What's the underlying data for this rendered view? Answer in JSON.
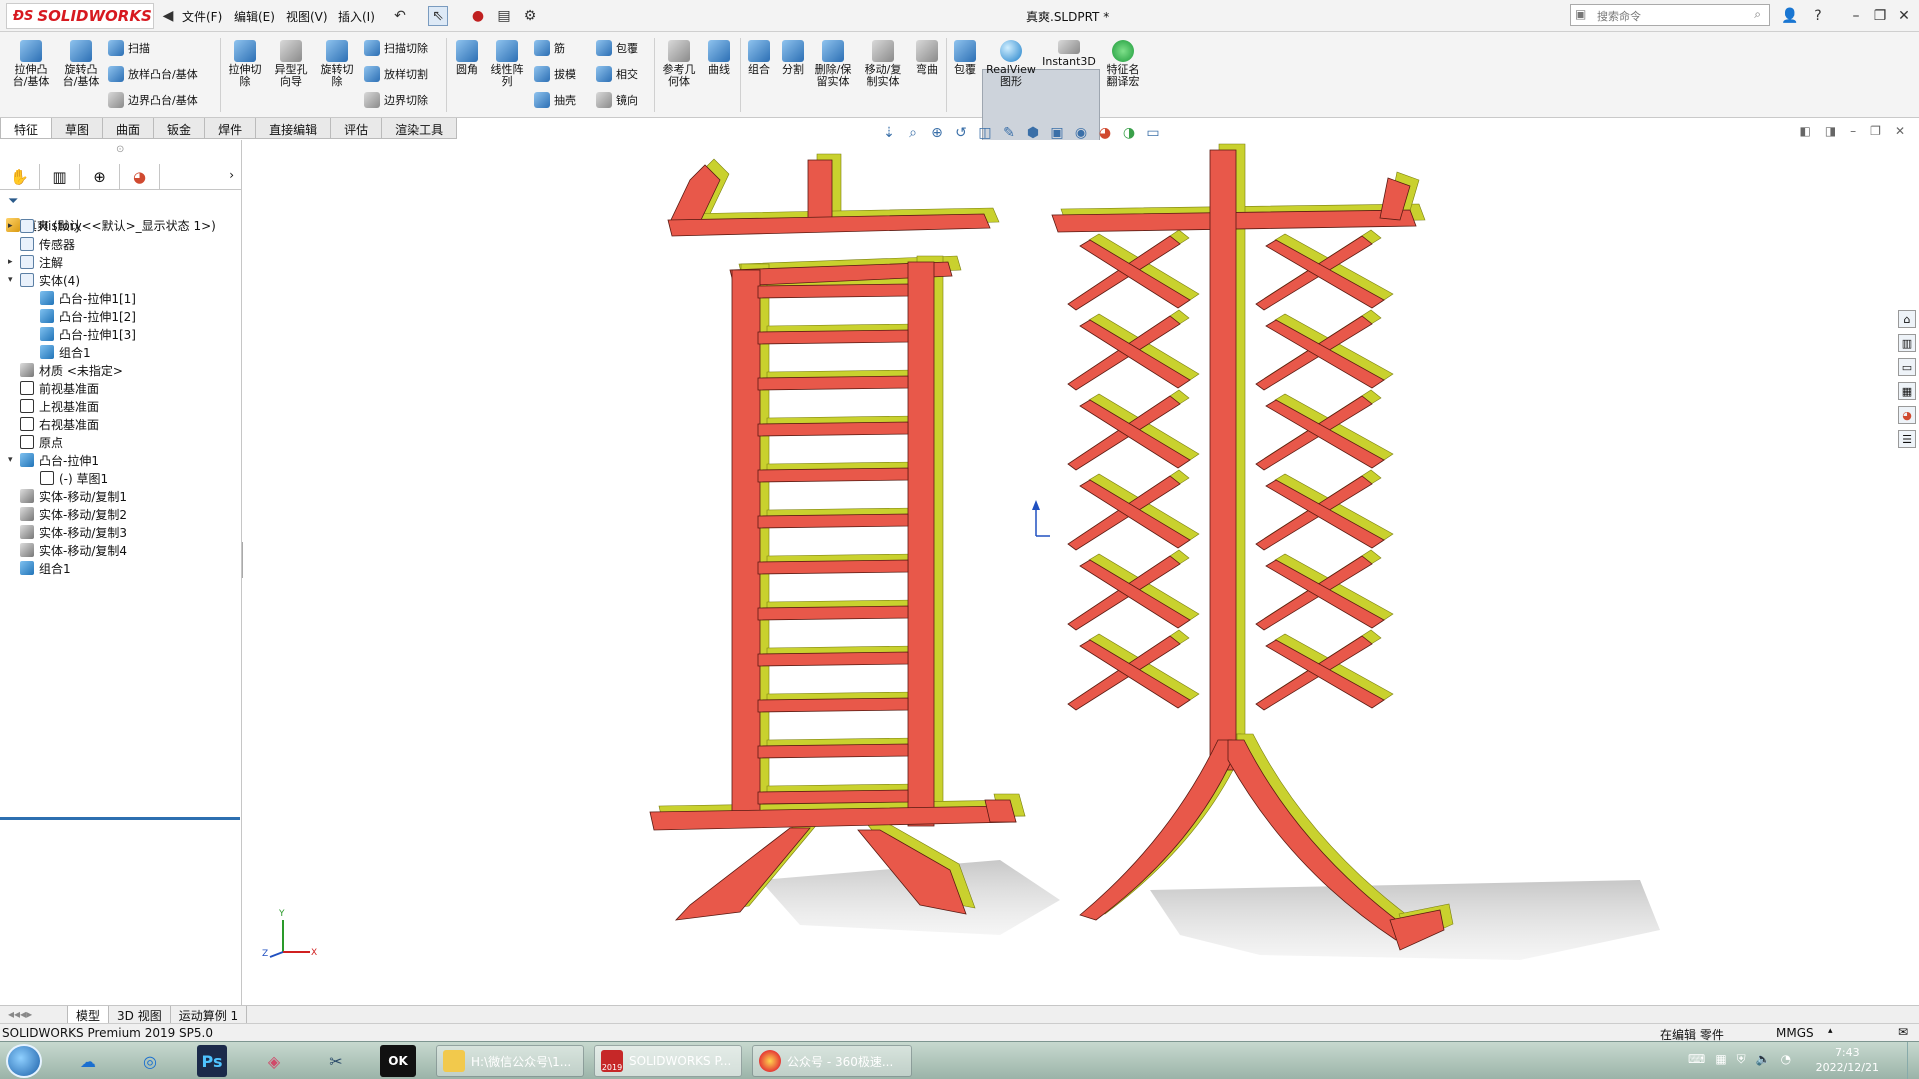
{
  "titlebar": {
    "app_brand": "SOLIDWORKS",
    "menus": [
      "文件(F)",
      "编辑(E)",
      "视图(V)",
      "插入(I)"
    ],
    "document_title": "真爽.SLDPRT *",
    "search_placeholder": "搜索命令",
    "help_symbol": "?"
  },
  "ribbon": {
    "large_buttons": [
      {
        "id": "extrude-boss",
        "label_lines": [
          "拉伸凸",
          "台/基体"
        ],
        "icon": "extrude-boss-icon"
      },
      {
        "id": "revolve-boss",
        "label_lines": [
          "旋转凸",
          "台/基体"
        ],
        "icon": "revolve-boss-icon"
      },
      {
        "id": "extrude-cut",
        "label_lines": [
          "拉伸切",
          "除"
        ],
        "icon": "extrude-cut-icon"
      },
      {
        "id": "hole-wizard",
        "label_lines": [
          "异型孔",
          "向导"
        ],
        "icon": "hole-wizard-icon"
      },
      {
        "id": "revolve-cut",
        "label_lines": [
          "旋转切",
          "除"
        ],
        "icon": "revolve-cut-icon"
      },
      {
        "id": "fillet",
        "label_lines": [
          "圆角"
        ],
        "icon": "fillet-icon"
      },
      {
        "id": "linear-pattern",
        "label_lines": [
          "线性阵",
          "列"
        ],
        "icon": "linear-pattern-icon"
      },
      {
        "id": "ref-geometry",
        "label_lines": [
          "参考几",
          "何体"
        ],
        "icon": "ref-geometry-icon"
      },
      {
        "id": "curves",
        "label_lines": [
          "曲线"
        ],
        "icon": "curves-icon"
      },
      {
        "id": "combine",
        "label_lines": [
          "组合"
        ],
        "icon": "combine-icon"
      },
      {
        "id": "split",
        "label_lines": [
          "分割"
        ],
        "icon": "split-icon"
      },
      {
        "id": "delete-keep-body",
        "label_lines": [
          "删除/保",
          "留实体"
        ],
        "icon": "delete-body-icon"
      },
      {
        "id": "move-copy-body",
        "label_lines": [
          "移动/复",
          "制实体"
        ],
        "icon": "move-copy-icon"
      },
      {
        "id": "flex",
        "label_lines": [
          "弯曲"
        ],
        "icon": "flex-icon"
      },
      {
        "id": "wrap",
        "label_lines": [
          "包覆"
        ],
        "icon": "wrap-icon"
      },
      {
        "id": "realview",
        "label_lines": [
          "RealView",
          "图形"
        ],
        "icon": "realview-globe-icon"
      },
      {
        "id": "instant3d",
        "label_lines": [
          "Instant3D"
        ],
        "icon": "instant3d-icon"
      },
      {
        "id": "feature-name-translate",
        "label_lines": [
          "特征名",
          "翻译宏"
        ],
        "icon": "translate-macro-icon"
      }
    ],
    "small_buttons": [
      {
        "id": "sweep",
        "label": "扫描"
      },
      {
        "id": "loft-boss",
        "label": "放样凸台/基体"
      },
      {
        "id": "boundary-boss",
        "label": "边界凸台/基体"
      },
      {
        "id": "swept-cut",
        "label": "扫描切除"
      },
      {
        "id": "lofted-cut",
        "label": "放样切割"
      },
      {
        "id": "boundary-cut",
        "label": "边界切除"
      },
      {
        "id": "rib",
        "label": "筋"
      },
      {
        "id": "draft",
        "label": "拔模"
      },
      {
        "id": "shell",
        "label": "抽壳"
      },
      {
        "id": "wrap-small",
        "label": "包覆"
      },
      {
        "id": "intersect",
        "label": "相交"
      },
      {
        "id": "mirror",
        "label": "镜向"
      }
    ]
  },
  "command_tabs": [
    "特征",
    "草图",
    "曲面",
    "钣金",
    "焊件",
    "直接编辑",
    "评估",
    "渲染工具"
  ],
  "feature_tree": {
    "root": "真爽  (默认<<默认>_显示状态 1>)",
    "items": [
      {
        "label": "History",
        "expander": "▸",
        "level": 0,
        "icon": "history-folder-icon"
      },
      {
        "label": "传感器",
        "expander": "",
        "level": 0,
        "icon": "sensor-folder-icon"
      },
      {
        "label": "注解",
        "expander": "▸",
        "level": 0,
        "icon": "annotation-icon"
      },
      {
        "label": "实体(4)",
        "expander": "▾",
        "level": 0,
        "icon": "solid-bodies-folder-icon"
      },
      {
        "label": "凸台-拉伸1[1]",
        "expander": "",
        "level": 1,
        "icon": "solid-body-icon"
      },
      {
        "label": "凸台-拉伸1[2]",
        "expander": "",
        "level": 1,
        "icon": "solid-body-icon"
      },
      {
        "label": "凸台-拉伸1[3]",
        "expander": "",
        "level": 1,
        "icon": "solid-body-icon"
      },
      {
        "label": "组合1",
        "expander": "",
        "level": 1,
        "icon": "solid-body-icon"
      },
      {
        "label": "材质 <未指定>",
        "expander": "",
        "level": 0,
        "icon": "material-icon"
      },
      {
        "label": "前视基准面",
        "expander": "",
        "level": 0,
        "icon": "plane-icon"
      },
      {
        "label": "上视基准面",
        "expander": "",
        "level": 0,
        "icon": "plane-icon"
      },
      {
        "label": "右视基准面",
        "expander": "",
        "level": 0,
        "icon": "plane-icon"
      },
      {
        "label": "原点",
        "expander": "",
        "level": 0,
        "icon": "origin-icon"
      },
      {
        "label": "凸台-拉伸1",
        "expander": "▾",
        "level": 0,
        "icon": "extrude-feature-icon"
      },
      {
        "label": "(-) 草图1",
        "expander": "",
        "level": 1,
        "icon": "sketch-icon"
      },
      {
        "label": "实体-移动/复制1",
        "expander": "",
        "level": 0,
        "icon": "move-copy-feature-icon"
      },
      {
        "label": "实体-移动/复制2",
        "expander": "",
        "level": 0,
        "icon": "move-copy-feature-icon"
      },
      {
        "label": "实体-移动/复制3",
        "expander": "",
        "level": 0,
        "icon": "move-copy-feature-icon"
      },
      {
        "label": "实体-移动/复制4",
        "expander": "",
        "level": 0,
        "icon": "move-copy-feature-icon"
      },
      {
        "label": "组合1",
        "expander": "",
        "level": 0,
        "icon": "combine-feature-icon"
      }
    ]
  },
  "viewport": {
    "model_text": "真爽",
    "face_color": "#e8584a",
    "side_color": "#c9d12e",
    "triad": {
      "x": "X",
      "y": "Y",
      "z": "Z"
    }
  },
  "model_tabs": [
    "模型",
    "3D 视图",
    "运动算例 1"
  ],
  "status": {
    "version": "SOLIDWORKS Premium 2019 SP5.0",
    "mode": "在编辑 零件",
    "units": "MMGS"
  },
  "taskbar": {
    "windows": [
      "H:\\微信公众号\\1...",
      "SOLIDWORKS P...",
      "公众号 - 360极速..."
    ],
    "sw_year": "2019",
    "time": "7:43",
    "date": "2022/12/21"
  }
}
